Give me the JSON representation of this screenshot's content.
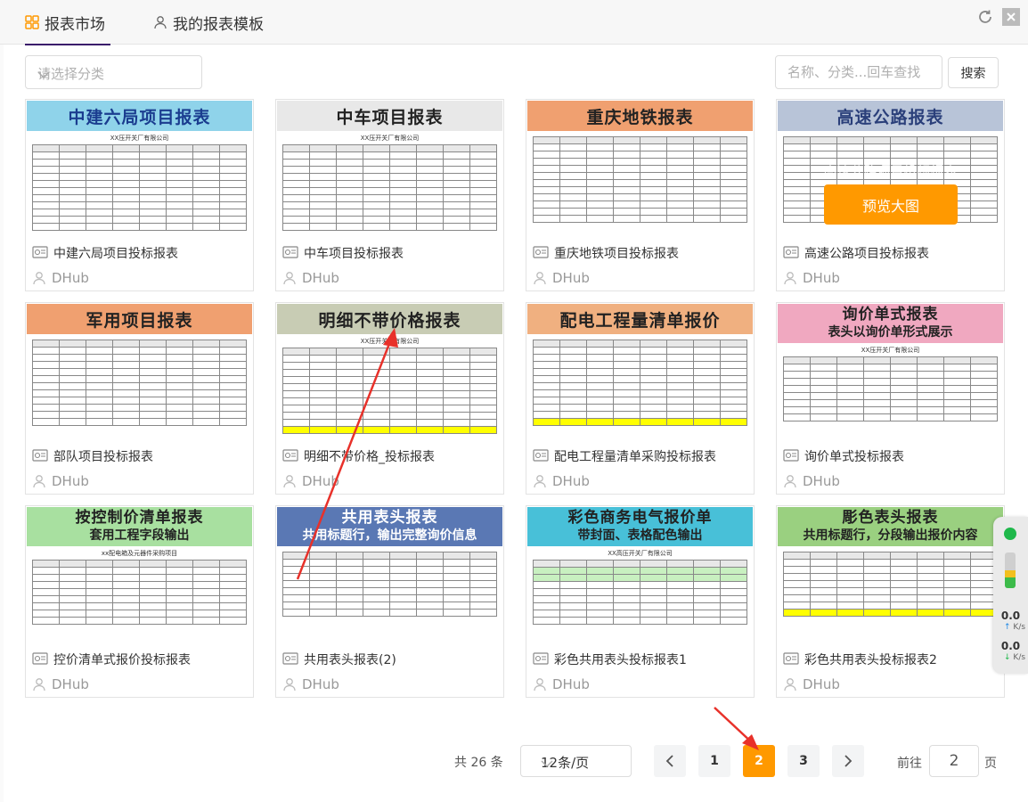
{
  "tabs": [
    {
      "label": "报表市场",
      "active": true
    },
    {
      "label": "我的报表模板",
      "active": false
    }
  ],
  "filter": {
    "category_placeholder": "请选择分类",
    "search_placeholder": "名称、分类...回车查找",
    "search_button": "搜索"
  },
  "cards": [
    {
      "title": "中建六局项目投标报表",
      "author": "DHub",
      "thumb_title": "中建六局项目报表",
      "thumb_sub": "",
      "thumb_caption": "XX压开关厂有限公司",
      "banner_bg": "#8fd3ea",
      "banner_color": "#1a3c8f"
    },
    {
      "title": "中车项目投标报表",
      "author": "DHub",
      "thumb_title": "中车项目报表",
      "thumb_sub": "",
      "thumb_caption": "XX压开关厂有限公司",
      "banner_bg": "#e8e8e8",
      "banner_color": "#222222"
    },
    {
      "title": "重庆地铁项目投标报表",
      "author": "DHub",
      "thumb_title": "重庆地铁报表",
      "thumb_sub": "",
      "thumb_caption": "",
      "banner_bg": "#f0a070",
      "banner_color": "#222222"
    },
    {
      "title": "高速公路项目投标报表",
      "author": "DHub",
      "thumb_title": "高速公路报表",
      "thumb_sub": "",
      "thumb_caption": "",
      "banner_bg": "#b8c4d8",
      "banner_color": "#2a3f7a",
      "hover": true,
      "overlay_text": "高速公路项目投标报表",
      "preview_label": "预览大图"
    },
    {
      "title": "部队项目投标报表",
      "author": "DHub",
      "thumb_title": "军用项目报表",
      "thumb_sub": "",
      "thumb_caption": "",
      "banner_bg": "#f0a070",
      "banner_color": "#222222"
    },
    {
      "title": "明细不带价格_投标报表",
      "author": "DHub",
      "thumb_title": "明细不带价格报表",
      "thumb_sub": "",
      "thumb_caption": "XX压开关厂有限公司",
      "banner_bg": "#c8ccb4",
      "banner_color": "#222222"
    },
    {
      "title": "配电工程量清单采购投标报表",
      "author": "DHub",
      "thumb_title": "配电工程量清单报价",
      "thumb_sub": "",
      "thumb_caption": "",
      "banner_bg": "#f0b080",
      "banner_color": "#222222"
    },
    {
      "title": "询价单式投标报表",
      "author": "DHub",
      "thumb_title": "询价单式报表",
      "thumb_sub": "表头以询价单形式展示",
      "thumb_caption": "XX压开关厂有限公司",
      "banner_bg": "#f0a8c0",
      "banner_color": "#222222"
    },
    {
      "title": "控价清单式报价投标报表",
      "author": "DHub",
      "thumb_title": "按控制价清单报表",
      "thumb_sub": "套用工程字段输出",
      "thumb_caption": "xx配电箱及元器件采购项目",
      "banner_bg": "#a8e0a0",
      "banner_color": "#222222"
    },
    {
      "title": "共用表头报表(2)",
      "author": "DHub",
      "thumb_title": "共用表头报表",
      "thumb_sub": "共用标题行，输出完整询价信息",
      "thumb_caption": "",
      "banner_bg": "#5a78b4",
      "banner_color": "#ffffff"
    },
    {
      "title": "彩色共用表头投标报表1",
      "author": "DHub",
      "thumb_title": "彩色商务电气报价单",
      "thumb_sub": "带封面、表格配色输出",
      "thumb_caption": "XX高压开关厂有限公司",
      "banner_bg": "#48c0d8",
      "banner_color": "#222222"
    },
    {
      "title": "彩色共用表头投标报表2",
      "author": "DHub",
      "thumb_title": "彫色表头报表",
      "thumb_sub": "共用标题行，分段输出报价内容",
      "thumb_caption": "",
      "banner_bg": "#9ad080",
      "banner_color": "#222222"
    }
  ],
  "pagination": {
    "total_text": "共 26 条",
    "page_size": "12条/页",
    "pages": [
      "1",
      "2",
      "3"
    ],
    "current_page": 2,
    "goto_label": "前往",
    "goto_value": "2",
    "goto_unit": "页"
  },
  "network": {
    "upload_value": "0.0",
    "upload_unit": "K/s",
    "download_value": "0.0",
    "download_unit": "K/s"
  },
  "colors": {
    "accent": "#ff9900",
    "tab_underline": "#3a1a6b",
    "annotation_arrow": "#e8312a"
  }
}
